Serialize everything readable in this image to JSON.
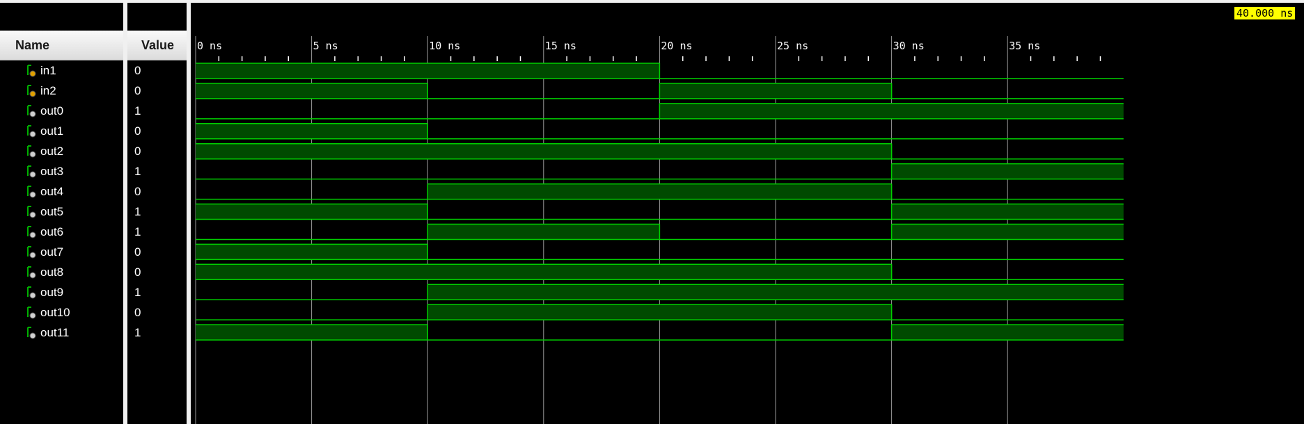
{
  "columns": {
    "name": "Name",
    "value": "Value"
  },
  "cursor_time": "40.000 ns",
  "ruler": {
    "unit": "ns",
    "start": 0,
    "end": 40,
    "major_step": 5,
    "minor_per_major": 5,
    "labels": [
      "0 ns",
      "5 ns",
      "10 ns",
      "15 ns",
      "20 ns",
      "25 ns",
      "30 ns",
      "35 ns"
    ]
  },
  "colors": {
    "background": "#000000",
    "trace": "#00d000",
    "fill_high": "#004a00",
    "grid": "#9a9a9a",
    "cursor_bg": "#ffff00"
  },
  "signals": [
    {
      "name": "in1",
      "value": "0",
      "kind": "input",
      "icon": "input-signal-icon",
      "transitions": [
        [
          0,
          1
        ],
        [
          20,
          0
        ]
      ]
    },
    {
      "name": "in2",
      "value": "0",
      "kind": "input",
      "icon": "input-signal-icon",
      "transitions": [
        [
          0,
          1
        ],
        [
          10,
          0
        ],
        [
          20,
          1
        ],
        [
          30,
          0
        ]
      ]
    },
    {
      "name": "out0",
      "value": "1",
      "kind": "output",
      "icon": "output-signal-icon",
      "transitions": [
        [
          0,
          0
        ],
        [
          20,
          1
        ]
      ]
    },
    {
      "name": "out1",
      "value": "0",
      "kind": "output",
      "icon": "output-signal-icon",
      "transitions": [
        [
          0,
          1
        ],
        [
          10,
          0
        ]
      ]
    },
    {
      "name": "out2",
      "value": "0",
      "kind": "output",
      "icon": "output-signal-icon",
      "transitions": [
        [
          0,
          1
        ],
        [
          30,
          0
        ]
      ]
    },
    {
      "name": "out3",
      "value": "1",
      "kind": "output",
      "icon": "output-signal-icon",
      "transitions": [
        [
          0,
          0
        ],
        [
          30,
          1
        ]
      ]
    },
    {
      "name": "out4",
      "value": "0",
      "kind": "output",
      "icon": "output-signal-icon",
      "transitions": [
        [
          0,
          0
        ],
        [
          10,
          1
        ],
        [
          30,
          0
        ]
      ]
    },
    {
      "name": "out5",
      "value": "1",
      "kind": "output",
      "icon": "output-signal-icon",
      "transitions": [
        [
          0,
          1
        ],
        [
          10,
          0
        ],
        [
          30,
          1
        ]
      ]
    },
    {
      "name": "out6",
      "value": "1",
      "kind": "output",
      "icon": "output-signal-icon",
      "transitions": [
        [
          0,
          0
        ],
        [
          10,
          1
        ],
        [
          20,
          0
        ],
        [
          30,
          1
        ]
      ]
    },
    {
      "name": "out7",
      "value": "0",
      "kind": "output",
      "icon": "output-signal-icon",
      "transitions": [
        [
          0,
          1
        ],
        [
          10,
          0
        ]
      ]
    },
    {
      "name": "out8",
      "value": "0",
      "kind": "output",
      "icon": "output-signal-icon",
      "transitions": [
        [
          0,
          1
        ],
        [
          30,
          0
        ]
      ]
    },
    {
      "name": "out9",
      "value": "1",
      "kind": "output",
      "icon": "output-signal-icon",
      "transitions": [
        [
          0,
          0
        ],
        [
          10,
          1
        ]
      ]
    },
    {
      "name": "out10",
      "value": "0",
      "kind": "output",
      "icon": "output-signal-icon",
      "transitions": [
        [
          0,
          0
        ],
        [
          10,
          1
        ],
        [
          30,
          0
        ]
      ]
    },
    {
      "name": "out11",
      "value": "1",
      "kind": "output",
      "icon": "output-signal-icon",
      "transitions": [
        [
          0,
          1
        ],
        [
          10,
          0
        ],
        [
          30,
          1
        ]
      ]
    }
  ]
}
